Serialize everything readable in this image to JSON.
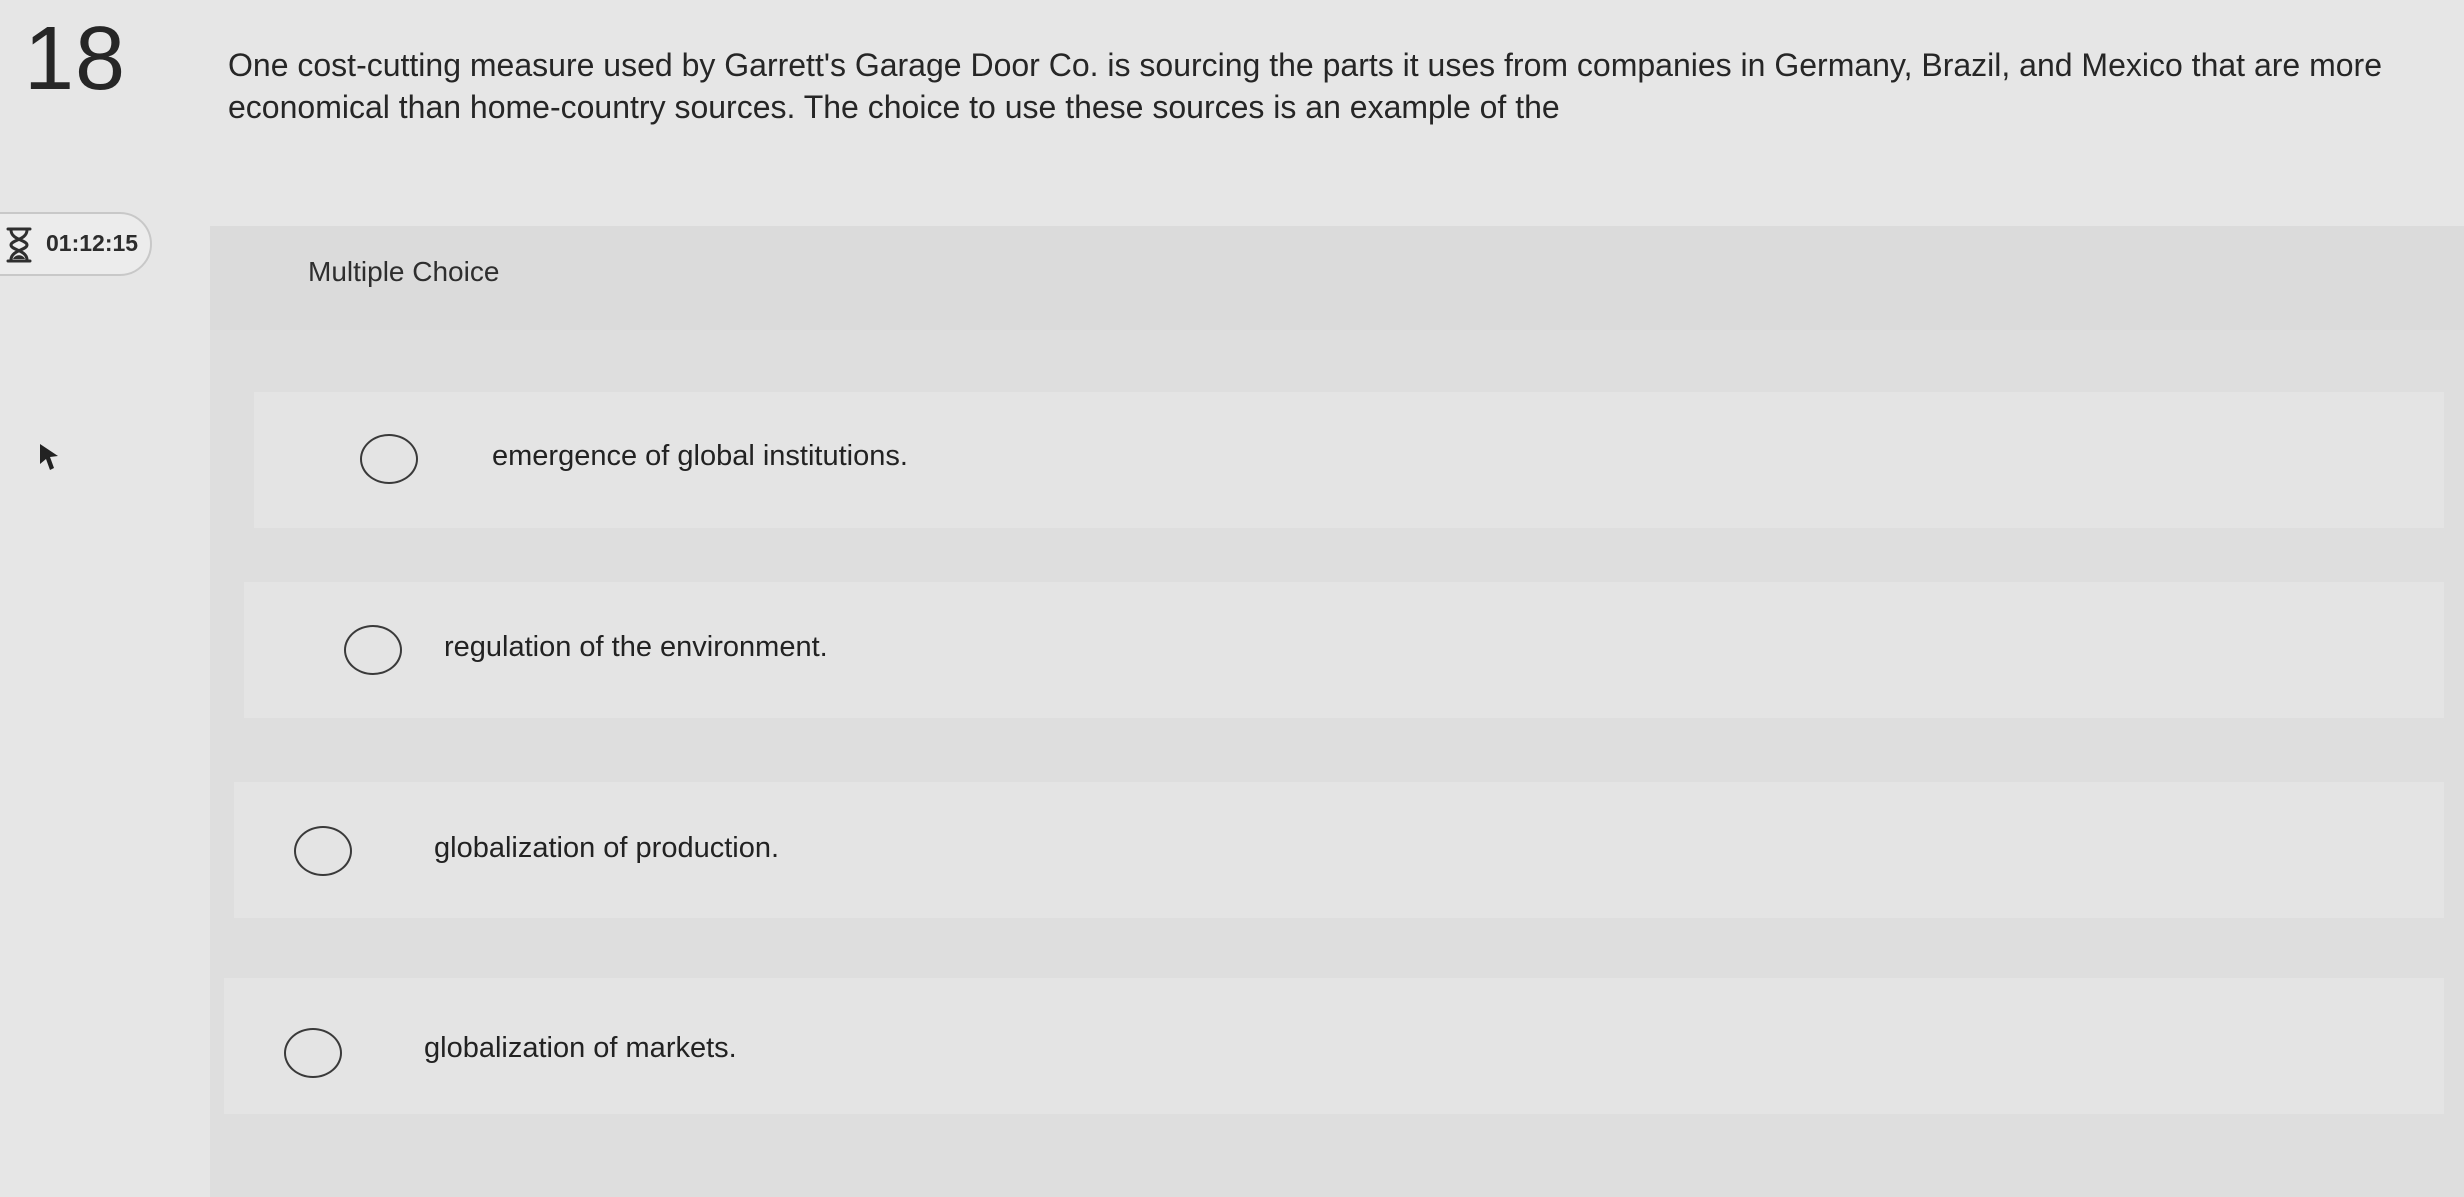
{
  "question": {
    "number": "18",
    "text": "One cost-cutting measure used by Garrett's Garage Door Co. is sourcing the parts it uses from companies in Germany, Brazil, and Mexico that are more economical than home-country sources. The choice to use these sources is an example of the"
  },
  "timer": {
    "icon": "hourglass-icon",
    "value": "01:12:15"
  },
  "section": {
    "label": "Multiple Choice"
  },
  "options": [
    {
      "label": "emergence of global institutions.",
      "selected": false
    },
    {
      "label": "regulation of the environment.",
      "selected": false
    },
    {
      "label": "globalization of production.",
      "selected": false
    },
    {
      "label": "globalization of markets.",
      "selected": false
    }
  ]
}
